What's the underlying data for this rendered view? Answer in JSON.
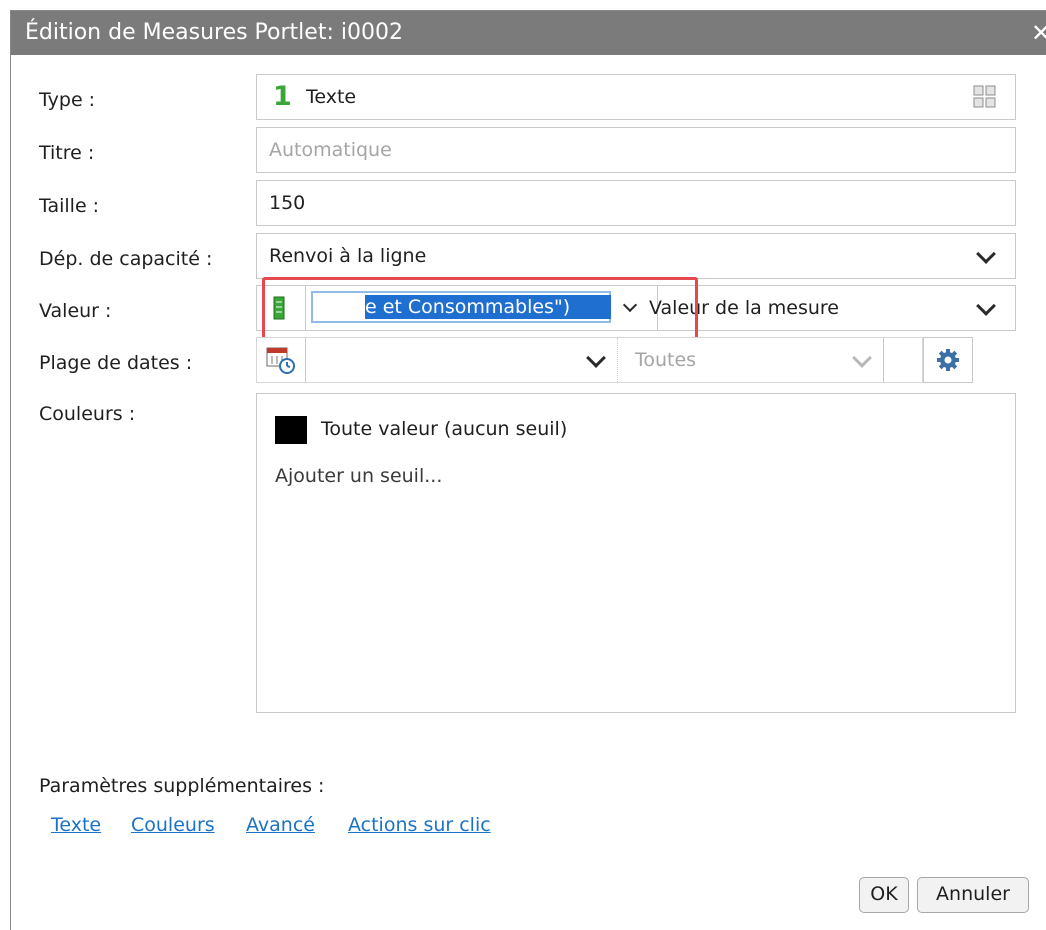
{
  "dialog": {
    "title": "Édition de Measures Portlet: i0002",
    "close_glyph": "✕"
  },
  "fields": {
    "type_label": "Type :",
    "type_number": "1",
    "type_value": "Texte",
    "titre_label": "Titre :",
    "titre_placeholder": "Automatique",
    "taille_label": "Taille :",
    "taille_value": "150",
    "dep_label": "Dép. de capacité :",
    "dep_value": "Renvoi à la ligne",
    "valeur_label": "Valeur :",
    "valeur_selected_text": "e et Consommables\")",
    "valeur_mode": "Valeur de la mesure",
    "plage_label": "Plage de dates :",
    "plage_value": "",
    "plage_range": "Toutes",
    "couleurs_label": "Couleurs :",
    "couleur_item": "Toute valeur (aucun seuil)",
    "couleur_swatch": "#000000",
    "add_threshold": "Ajouter un seuil..."
  },
  "extras": {
    "label": "Paramètres supplémentaires :",
    "links": [
      "Texte",
      "Couleurs",
      "Avancé",
      "Actions sur clic"
    ]
  },
  "buttons": {
    "ok": "OK",
    "cancel": "Annuler"
  },
  "icons": {
    "type_grid": "grid-icon",
    "measure": "measure-icon",
    "calendar": "calendar-clock-icon",
    "settings": "gear-icon"
  },
  "colors": {
    "titlebar": "#7b7b7b",
    "type_number": "#3aa63a",
    "selection": "#1f6fd1",
    "highlight_border": "#e5484d",
    "link": "#1a73c7"
  }
}
